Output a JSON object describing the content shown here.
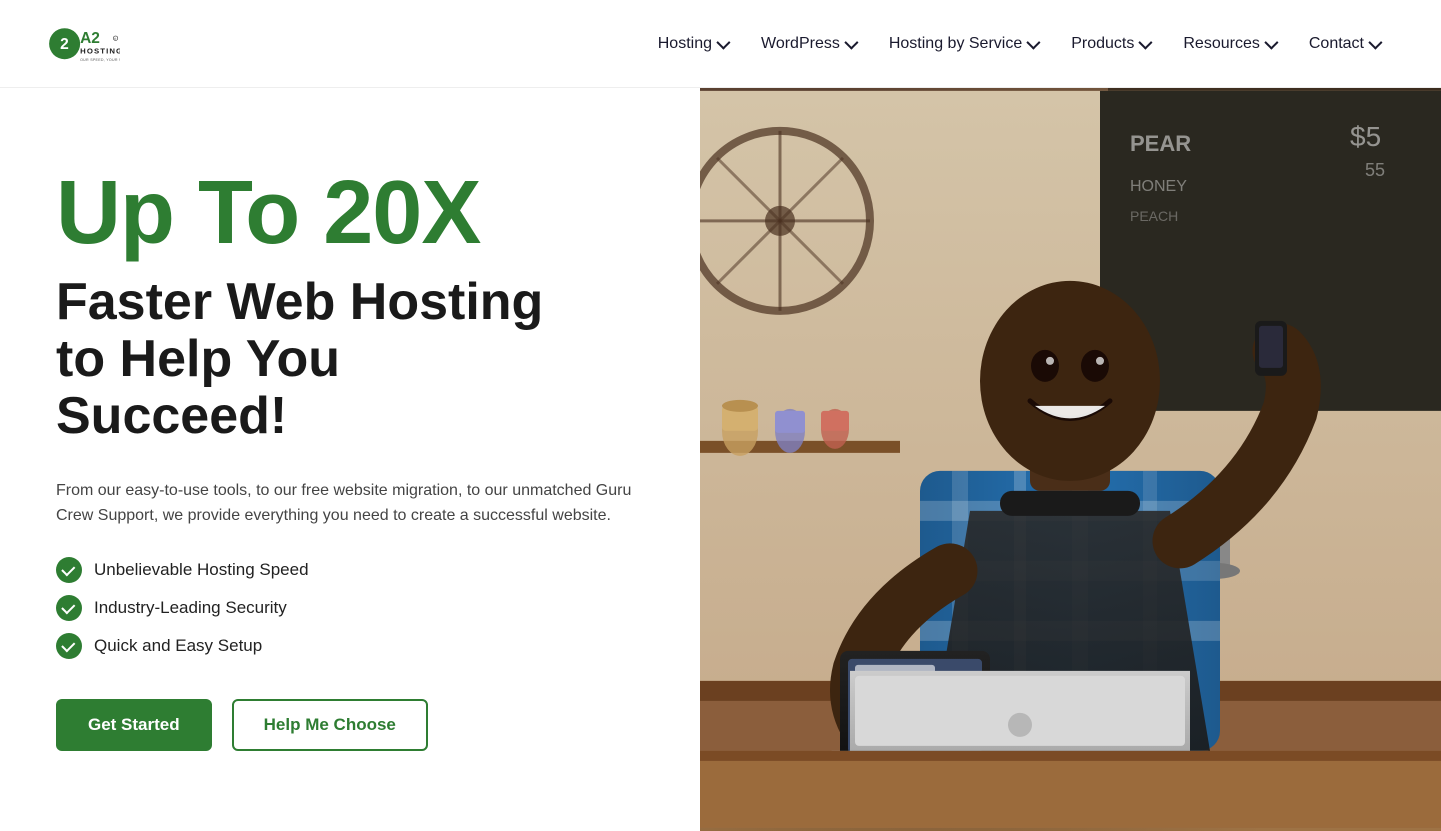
{
  "logo": {
    "alt": "A2 Hosting - Our Speed, Your Success",
    "tagline": "OUR SPEED, YOUR SUCCESS"
  },
  "nav": {
    "items": [
      {
        "label": "Hosting",
        "hasDropdown": true
      },
      {
        "label": "WordPress",
        "hasDropdown": true
      },
      {
        "label": "Hosting by Service",
        "hasDropdown": true
      },
      {
        "label": "Products",
        "hasDropdown": true
      },
      {
        "label": "Resources",
        "hasDropdown": true
      },
      {
        "label": "Contact",
        "hasDropdown": true
      }
    ]
  },
  "hero": {
    "title_green": "Up To 20X",
    "subtitle_line1": "Faster Web Hosting",
    "subtitle_line2": "to Help You",
    "subtitle_line3": "Succeed!",
    "description": "From our easy-to-use tools, to our free website migration, to our unmatched Guru Crew Support, we provide everything you need to create a successful website.",
    "features": [
      "Unbelievable Hosting Speed",
      "Industry-Leading Security",
      "Quick and Easy Setup"
    ],
    "cta_primary": "Get Started",
    "cta_secondary": "Help Me Choose"
  }
}
